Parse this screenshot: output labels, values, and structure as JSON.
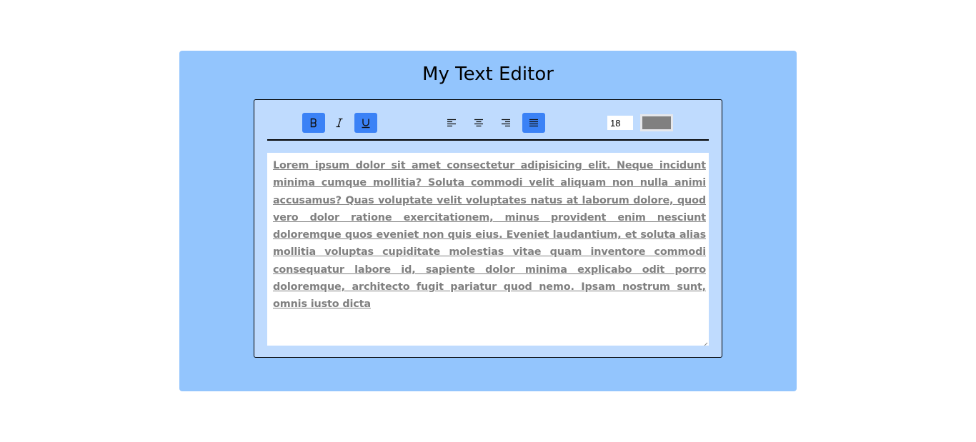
{
  "app": {
    "title": "My Text Editor"
  },
  "toolbar": {
    "bold": {
      "icon": "bold-icon",
      "active": true
    },
    "italic": {
      "icon": "italic-icon",
      "active": false
    },
    "underline": {
      "icon": "underline-icon",
      "active": true
    },
    "align_left": {
      "icon": "align-left-icon",
      "active": false
    },
    "align_center": {
      "icon": "align-center-icon",
      "active": false
    },
    "align_right": {
      "icon": "align-right-icon",
      "active": false
    },
    "align_justify": {
      "icon": "align-justify-icon",
      "active": true
    },
    "font_size": "18",
    "text_color": "#808080"
  },
  "colors": {
    "card_bg": "#93c5fd",
    "editor_bg": "#bfdbfe",
    "active_button": "#3b82f6"
  },
  "editor": {
    "text": "Lorem ipsum dolor sit amet consectetur adipisicing elit. Neque incidunt minima cumque mollitia? Soluta commodi velit aliquam non nulla animi accusamus? Quas voluptate velit voluptates natus at laborum dolore, quod vero dolor ratione exercitationem, minus provident enim nesciunt doloremque quos eveniet non quis eius. Eveniet laudantium, et soluta alias mollitia voluptas cupiditate molestias vitae quam inventore commodi consequatur labore id, sapiente dolor minima explicabo odit porro doloremque, architecto fugit pariatur quod nemo. Ipsam nostrum sunt, omnis iusto dicta"
  }
}
